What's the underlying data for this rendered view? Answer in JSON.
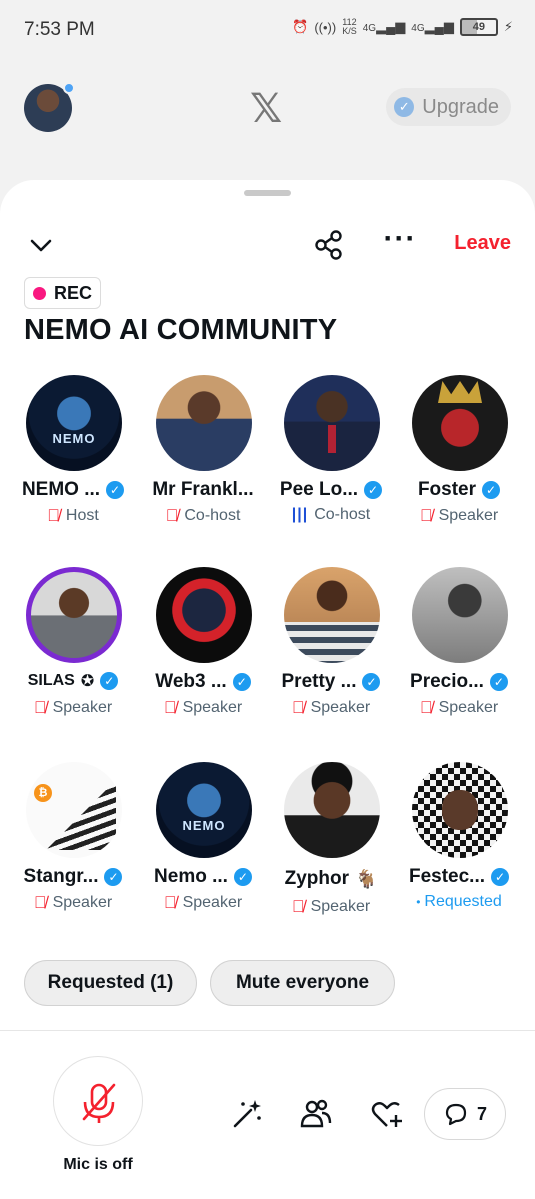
{
  "status_bar": {
    "time": "7:53 PM",
    "net_speed": "112",
    "net_unit": "K/S",
    "signal1": "4G",
    "signal2": "4G",
    "battery": "49"
  },
  "header": {
    "logo": "𝕏",
    "upgrade_label": "Upgrade"
  },
  "space": {
    "rec_label": "REC",
    "title": "NEMO AI COMMUNITY",
    "leave_label": "Leave"
  },
  "participants": [
    {
      "name": "NEMO ...",
      "role": "Host",
      "verified": true,
      "status": "muted"
    },
    {
      "name": "Mr Frankl...",
      "role": "Co-host",
      "verified": false,
      "status": "muted"
    },
    {
      "name": "Pee Lo...",
      "role": "Co-host",
      "verified": true,
      "status": "speaking"
    },
    {
      "name": "Foster",
      "role": "Speaker",
      "verified": true,
      "status": "muted"
    },
    {
      "name": "SILAS",
      "role": "Speaker",
      "verified": true,
      "status": "muted"
    },
    {
      "name": "Web3 ...",
      "role": "Speaker",
      "verified": true,
      "status": "muted"
    },
    {
      "name": "Pretty ...",
      "role": "Speaker",
      "verified": true,
      "status": "muted"
    },
    {
      "name": "Precio...",
      "role": "Speaker",
      "verified": true,
      "status": "muted"
    },
    {
      "name": "Stangr...",
      "role": "Speaker",
      "verified": true,
      "status": "muted"
    },
    {
      "name": "Nemo ...",
      "role": "Speaker",
      "verified": true,
      "status": "muted"
    },
    {
      "name": "Zyphor",
      "role": "Speaker",
      "verified": false,
      "status": "muted"
    },
    {
      "name": "Festec...",
      "role": "Requested",
      "verified": true,
      "status": "requested"
    }
  ],
  "actions": {
    "requested_label": "Requested (1)",
    "mute_everyone_label": "Mute everyone"
  },
  "controls": {
    "mic_label": "Mic is off",
    "chat_count": "7"
  },
  "colors": {
    "leave": "#f4212e",
    "verified": "#1d9bf0",
    "rec": "#f91880"
  }
}
